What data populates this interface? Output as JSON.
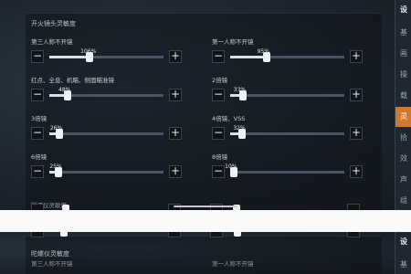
{
  "section_title": "开火镜头灵敏度",
  "groups": [
    {
      "label": "第三人称不开镜",
      "value": 106,
      "pct": "106%"
    },
    {
      "label": "第一人称不开镜",
      "value": 95,
      "pct": "95%"
    },
    {
      "label": "红点、全息、机瞄、侧面瞄准镜",
      "value": 48,
      "pct": "48%"
    },
    {
      "label": "2倍镜",
      "value": 33,
      "pct": "33%"
    },
    {
      "label": "3倍镜",
      "value": 26,
      "pct": "26%"
    },
    {
      "label": "4倍镜、VSS",
      "value": 32,
      "pct": "32%"
    },
    {
      "label": "6倍镜",
      "value": 25,
      "pct": "25%"
    },
    {
      "label": "8倍镜",
      "value": 10,
      "pct": "10%"
    }
  ],
  "slider_max": 300,
  "next_section_title": "陀螺仪灵敏度",
  "partial_section_title": "陀螺仪灵敏度",
  "bottom_labels": [
    "第三人称不开镜",
    "第一人称不开镜"
  ],
  "sidebar_top": [
    {
      "text": "设",
      "state": "head"
    },
    {
      "text": "基",
      "state": ""
    },
    {
      "text": "画",
      "state": ""
    },
    {
      "text": "操",
      "state": ""
    },
    {
      "text": "载",
      "state": ""
    },
    {
      "text": "灵",
      "state": "active"
    },
    {
      "text": "拾",
      "state": ""
    },
    {
      "text": "效",
      "state": ""
    },
    {
      "text": "声",
      "state": ""
    },
    {
      "text": "组",
      "state": ""
    }
  ],
  "sidebar_bottom": [
    {
      "text": "设",
      "state": "head"
    },
    {
      "text": "基",
      "state": ""
    }
  ],
  "minus_symbol": "−",
  "plus_symbol": "+"
}
